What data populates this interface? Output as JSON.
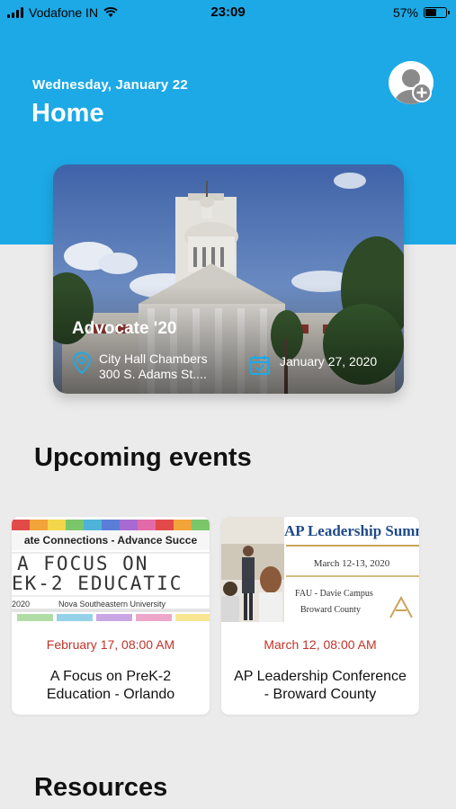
{
  "status_bar": {
    "carrier": "Vodafone IN",
    "time": "23:09",
    "battery": "57%",
    "battery_level": 0.57
  },
  "header": {
    "date": "Wednesday, January 22",
    "title": "Home"
  },
  "featured": {
    "title": "Advocate '20",
    "location_line1": "City Hall Chambers",
    "location_line2": "300 S. Adams St....",
    "date": "January 27, 2020"
  },
  "sections": {
    "upcoming": "Upcoming events",
    "resources": "Resources"
  },
  "events": [
    {
      "date": "February 17, 08:00 AM",
      "name": "A Focus on PreK-2 Education - Orlando",
      "banner_top": "ate Connections - Advance Succe",
      "banner_line1": "A FOCUS ON",
      "banner_line2": "EK-2 EDUCATIC",
      "banner_year": "2020",
      "banner_org": "Nova Southeastern University"
    },
    {
      "date": "March 12, 08:00 AM",
      "name": "AP Leadership Conference - Broward County",
      "banner_title": "AP Leadership Summit",
      "banner_dates": "March 12-13, 2020",
      "banner_venue": "FAU - Davie Campus",
      "banner_county": "Broward County"
    }
  ],
  "colors": {
    "header_blue": "#1da9e6",
    "event_date_red": "#c2332a",
    "background": "#ebebeb"
  }
}
